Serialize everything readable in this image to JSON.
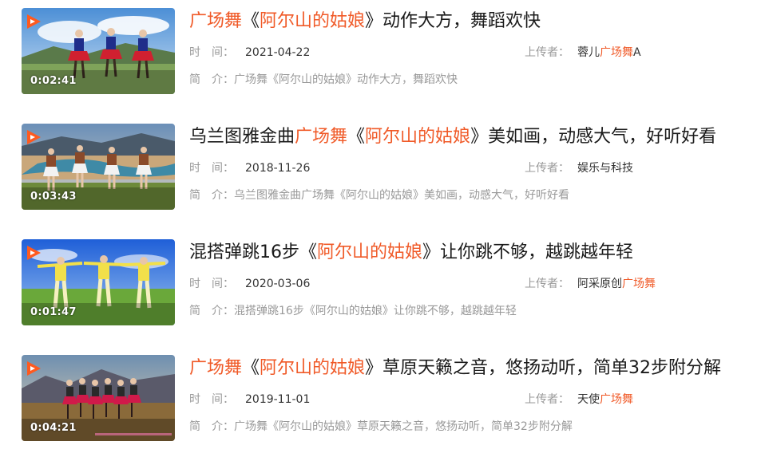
{
  "items": [
    {
      "duration": "0:02:41",
      "title_parts": [
        "广场舞",
        "《",
        "阿尔山的姑娘",
        "》动作大方，舞蹈欢快"
      ],
      "time_label": "时　间：",
      "date": "2021-04-22",
      "uploader_label": "上传者：",
      "uploader_parts": [
        "蓉儿",
        "广场舞",
        "A"
      ],
      "desc_label": "简　介：",
      "desc": "广场舞《阿尔山的姑娘》动作大方，舞蹈欢快"
    },
    {
      "duration": "0:03:43",
      "title_parts": [
        "乌兰图雅金曲",
        "广场舞",
        "《",
        "阿尔山的姑娘",
        "》美如画，动感大气，好听好看"
      ],
      "time_label": "时　间：",
      "date": "2018-11-26",
      "uploader_label": "上传者：",
      "uploader_parts": [
        "娱乐与科技"
      ],
      "desc_label": "简　介：",
      "desc": "乌兰图雅金曲广场舞《阿尔山的姑娘》美如画，动感大气，好听好看"
    },
    {
      "duration": "0:01:47",
      "title_parts": [
        "混搭弹跳16步《",
        "阿尔山的姑娘",
        "》让你跳不够，越跳越年轻"
      ],
      "time_label": "时　间：",
      "date": "2020-03-06",
      "uploader_label": "上传者：",
      "uploader_parts": [
        "阿采原创",
        "广场舞"
      ],
      "desc_label": "简　介：",
      "desc": "混搭弹跳16步《阿尔山的姑娘》让你跳不够，越跳越年轻"
    },
    {
      "duration": "0:04:21",
      "title_parts": [
        "广场舞",
        "《",
        "阿尔山的姑娘",
        "》草原天籁之音，悠扬动听，简单32步附分解"
      ],
      "time_label": "时　间：",
      "date": "2019-11-01",
      "uploader_label": "上传者：",
      "uploader_parts": [
        "天使",
        "广场舞"
      ],
      "desc_label": "简　介：",
      "desc": "广场舞《阿尔山的姑娘》草原天籁之音，悠扬动听，简单32步附分解"
    }
  ],
  "colors": {
    "highlight": "#f05a28",
    "title": "#1a1a1a",
    "meta_label": "#999999",
    "meta_value": "#333333",
    "play_badge": "#ff5a1f"
  },
  "icons": {
    "play_badge": "play-logo-icon"
  }
}
